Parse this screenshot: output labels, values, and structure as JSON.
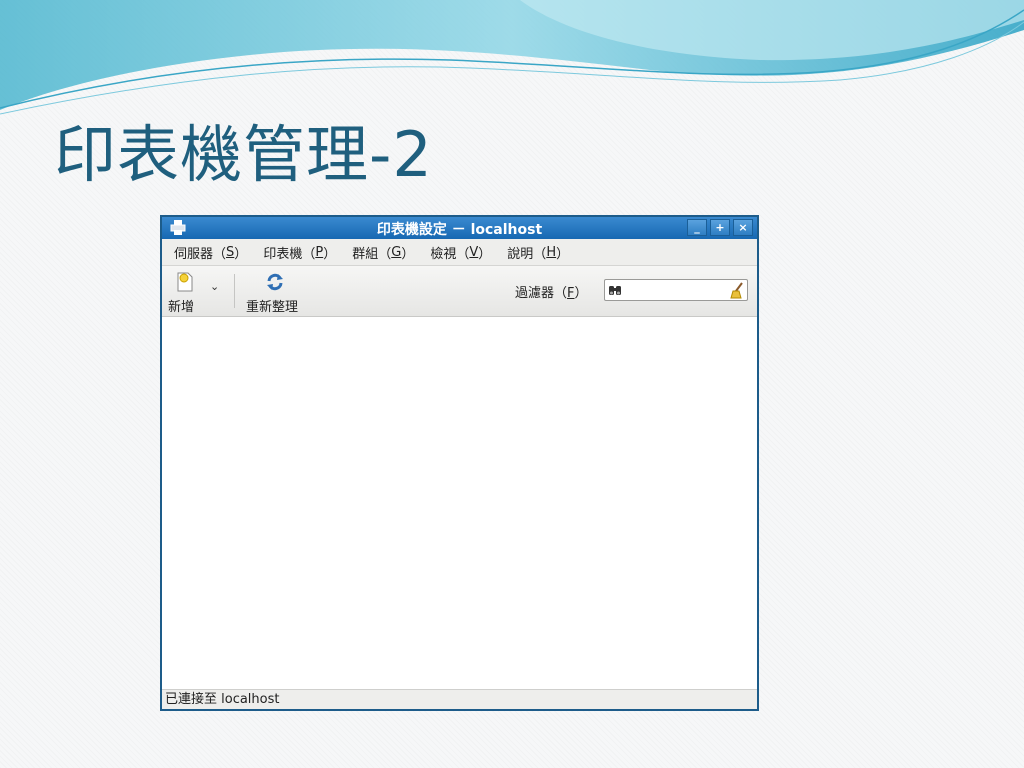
{
  "slide": {
    "title": "印表機管理-2"
  },
  "window": {
    "title": "印表機設定 － localhost",
    "controls": {
      "minimize": "_",
      "maximize": "+",
      "close": "×"
    }
  },
  "menubar": {
    "items": [
      {
        "label": "伺服器",
        "mnemonic": "S"
      },
      {
        "label": "印表機",
        "mnemonic": "P"
      },
      {
        "label": "群組",
        "mnemonic": "G"
      },
      {
        "label": "檢視",
        "mnemonic": "V"
      },
      {
        "label": "說明",
        "mnemonic": "H"
      }
    ]
  },
  "toolbar": {
    "new_label": "新增",
    "new_arrow": "⌄",
    "refresh_label": "重新整理",
    "filter_label": "過濾器",
    "filter_mnemonic": "F",
    "filter_value": ""
  },
  "statusbar": {
    "text": "已連接至 localhost"
  },
  "icons": {
    "window": "printer-icon",
    "new": "new-document-icon",
    "refresh": "refresh-icon",
    "search": "binoculars-icon",
    "clear": "broom-icon"
  },
  "colors": {
    "title_text": "#1f5f7e",
    "titlebar": "#1768b2",
    "window_border": "#1d5c8a"
  }
}
